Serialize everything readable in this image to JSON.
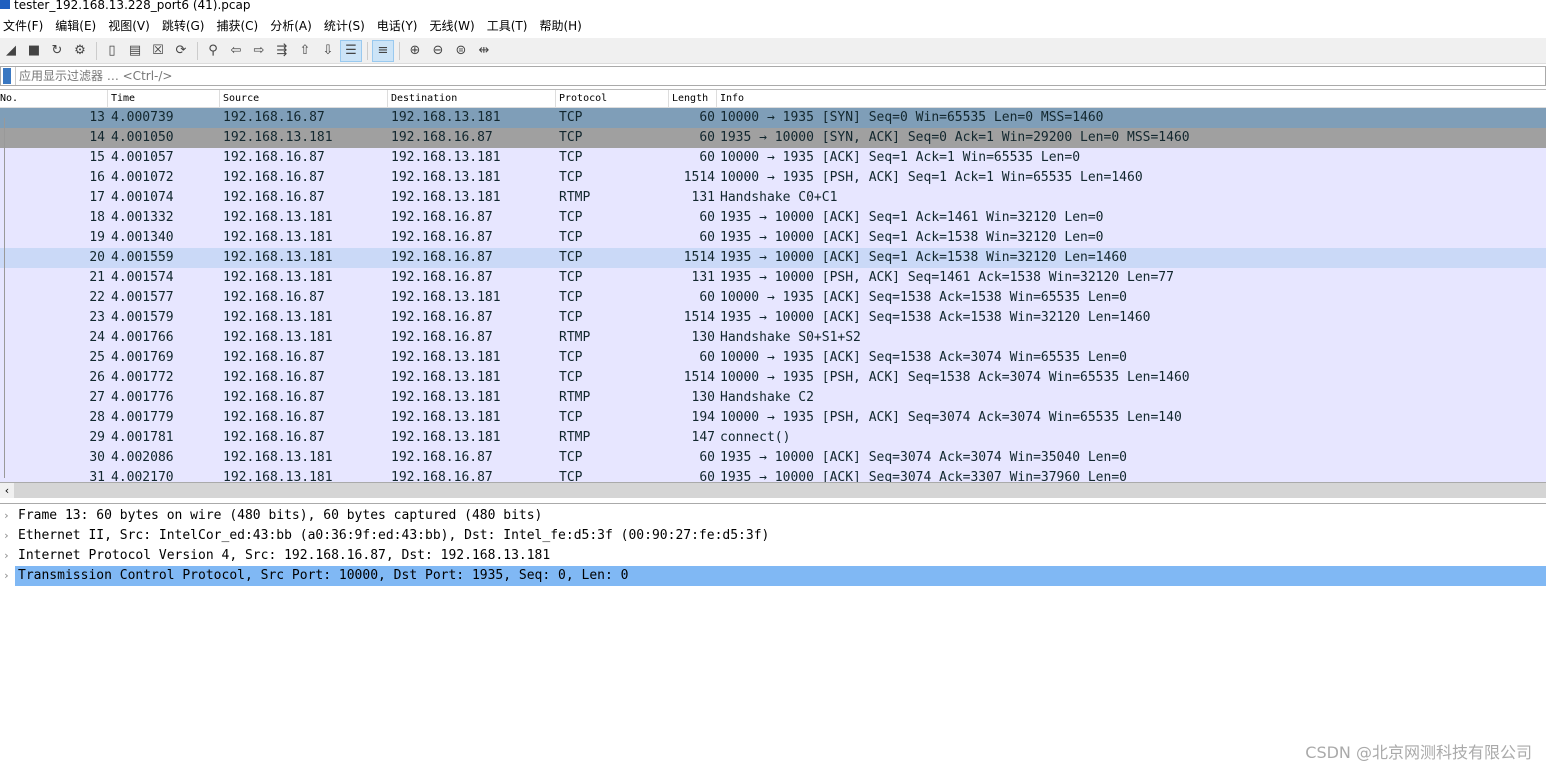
{
  "window": {
    "title": "tester_192.168.13.228_port6 (41).pcap"
  },
  "menu": [
    "文件(F)",
    "编辑(E)",
    "视图(V)",
    "跳转(G)",
    "捕获(C)",
    "分析(A)",
    "统计(S)",
    "电话(Y)",
    "无线(W)",
    "工具(T)",
    "帮助(H)"
  ],
  "toolbar": [
    {
      "icon": "shark-fin-start-icon",
      "glyph": "◢"
    },
    {
      "icon": "stop-icon",
      "glyph": "■"
    },
    {
      "icon": "restart-icon",
      "glyph": "↻"
    },
    {
      "icon": "capture-options-icon",
      "glyph": "⚙"
    },
    {
      "sep": true
    },
    {
      "icon": "open-file-icon",
      "glyph": "▯"
    },
    {
      "icon": "save-file-icon",
      "glyph": "▤"
    },
    {
      "icon": "close-file-icon",
      "glyph": "☒"
    },
    {
      "icon": "reload-icon",
      "glyph": "⟳"
    },
    {
      "sep": true
    },
    {
      "icon": "find-icon",
      "glyph": "⚲"
    },
    {
      "icon": "go-back-icon",
      "glyph": "⇦"
    },
    {
      "icon": "go-forward-icon",
      "glyph": "⇨"
    },
    {
      "icon": "go-to-packet-icon",
      "glyph": "⇶"
    },
    {
      "icon": "first-packet-icon",
      "glyph": "⇧"
    },
    {
      "icon": "last-packet-icon",
      "glyph": "⇩"
    },
    {
      "icon": "autoscroll-icon",
      "glyph": "☰",
      "on": true
    },
    {
      "sep": true
    },
    {
      "icon": "colorize-icon",
      "glyph": "≡",
      "on": true
    },
    {
      "sep": true
    },
    {
      "icon": "zoom-in-icon",
      "glyph": "⊕"
    },
    {
      "icon": "zoom-out-icon",
      "glyph": "⊖"
    },
    {
      "icon": "zoom-normal-icon",
      "glyph": "⊜"
    },
    {
      "icon": "resize-columns-icon",
      "glyph": "⇹"
    }
  ],
  "filter": {
    "placeholder": "应用显示过滤器 … <Ctrl-/>"
  },
  "columns": [
    "No.",
    "Time",
    "Source",
    "Destination",
    "Protocol",
    "Length",
    "Info"
  ],
  "packets": [
    [
      "13",
      "4.000739",
      "192.168.16.87",
      "192.168.13.181",
      "TCP",
      "60",
      "10000 → 1935 [SYN] Seq=0 Win=65535 Len=0 MSS=1460"
    ],
    [
      "14",
      "4.001050",
      "192.168.13.181",
      "192.168.16.87",
      "TCP",
      "60",
      "1935 → 10000 [SYN, ACK] Seq=0 Ack=1 Win=29200 Len=0 MSS=1460"
    ],
    [
      "15",
      "4.001057",
      "192.168.16.87",
      "192.168.13.181",
      "TCP",
      "60",
      "10000 → 1935 [ACK] Seq=1 Ack=1 Win=65535 Len=0"
    ],
    [
      "16",
      "4.001072",
      "192.168.16.87",
      "192.168.13.181",
      "TCP",
      "1514",
      "10000 → 1935 [PSH, ACK] Seq=1 Ack=1 Win=65535 Len=1460"
    ],
    [
      "17",
      "4.001074",
      "192.168.16.87",
      "192.168.13.181",
      "RTMP",
      "131",
      "Handshake C0+C1"
    ],
    [
      "18",
      "4.001332",
      "192.168.13.181",
      "192.168.16.87",
      "TCP",
      "60",
      "1935 → 10000 [ACK] Seq=1 Ack=1461 Win=32120 Len=0"
    ],
    [
      "19",
      "4.001340",
      "192.168.13.181",
      "192.168.16.87",
      "TCP",
      "60",
      "1935 → 10000 [ACK] Seq=1 Ack=1538 Win=32120 Len=0"
    ],
    [
      "20",
      "4.001559",
      "192.168.13.181",
      "192.168.16.87",
      "TCP",
      "1514",
      "1935 → 10000 [ACK] Seq=1 Ack=1538 Win=32120 Len=1460"
    ],
    [
      "21",
      "4.001574",
      "192.168.13.181",
      "192.168.16.87",
      "TCP",
      "131",
      "1935 → 10000 [PSH, ACK] Seq=1461 Ack=1538 Win=32120 Len=77"
    ],
    [
      "22",
      "4.001577",
      "192.168.16.87",
      "192.168.13.181",
      "TCP",
      "60",
      "10000 → 1935 [ACK] Seq=1538 Ack=1538 Win=65535 Len=0"
    ],
    [
      "23",
      "4.001579",
      "192.168.13.181",
      "192.168.16.87",
      "TCP",
      "1514",
      "1935 → 10000 [ACK] Seq=1538 Ack=1538 Win=32120 Len=1460"
    ],
    [
      "24",
      "4.001766",
      "192.168.13.181",
      "192.168.16.87",
      "RTMP",
      "130",
      "Handshake S0+S1+S2"
    ],
    [
      "25",
      "4.001769",
      "192.168.16.87",
      "192.168.13.181",
      "TCP",
      "60",
      "10000 → 1935 [ACK] Seq=1538 Ack=3074 Win=65535 Len=0"
    ],
    [
      "26",
      "4.001772",
      "192.168.16.87",
      "192.168.13.181",
      "TCP",
      "1514",
      "10000 → 1935 [PSH, ACK] Seq=1538 Ack=3074 Win=65535 Len=1460"
    ],
    [
      "27",
      "4.001776",
      "192.168.16.87",
      "192.168.13.181",
      "RTMP",
      "130",
      "Handshake C2"
    ],
    [
      "28",
      "4.001779",
      "192.168.16.87",
      "192.168.13.181",
      "TCP",
      "194",
      "10000 → 1935 [PSH, ACK] Seq=3074 Ack=3074 Win=65535 Len=140"
    ],
    [
      "29",
      "4.001781",
      "192.168.16.87",
      "192.168.13.181",
      "RTMP",
      "147",
      "connect()"
    ],
    [
      "30",
      "4.002086",
      "192.168.13.181",
      "192.168.16.87",
      "TCP",
      "60",
      "1935 → 10000 [ACK] Seq=3074 Ack=3074 Win=35040 Len=0"
    ],
    [
      "31",
      "4.002170",
      "192.168.13.181",
      "192.168.16.87",
      "TCP",
      "60",
      "1935 → 10000 [ACK] Seq=3074 Ack=3307 Win=37960 Len=0"
    ]
  ],
  "selected_packet": "13",
  "details": [
    "Frame 13: 60 bytes on wire (480 bits), 60 bytes captured (480 bits)",
    "Ethernet II, Src: IntelCor_ed:43:bb (a0:36:9f:ed:43:bb), Dst: Intel_fe:d5:3f (00:90:27:fe:d5:3f)",
    "Internet Protocol Version 4, Src: 192.168.16.87, Dst: 192.168.13.181",
    "Transmission Control Protocol, Src Port: 10000, Dst Port: 1935, Seq: 0, Len: 0"
  ],
  "watermark": "CSDN @北京网测科技有限公司"
}
